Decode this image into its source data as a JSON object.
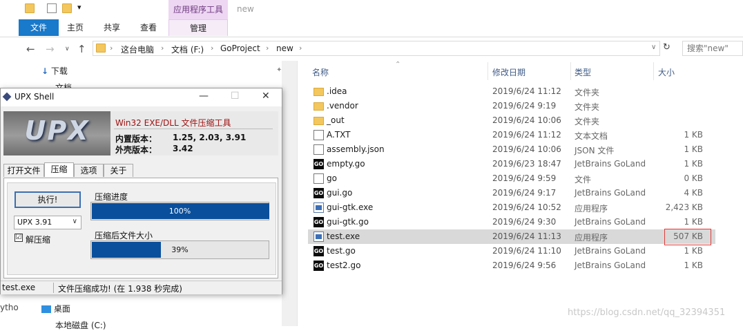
{
  "ribbon": {
    "contextual_tab": "应用程序工具",
    "window_title": "new",
    "tabs": [
      "文件",
      "主页",
      "共享",
      "查看",
      "管理"
    ]
  },
  "address": {
    "crumbs": [
      "这台电脑",
      "文档 (F:)",
      "GoProject",
      "new"
    ],
    "search_placeholder": "搜索\"new\""
  },
  "navpane": {
    "items": [
      "下载",
      "文档",
      "桌面",
      "本地磁盘 (C:)",
      "ytho"
    ]
  },
  "columns": {
    "name": "名称",
    "date": "修改日期",
    "type": "类型",
    "size": "大小"
  },
  "files": [
    {
      "name": ".idea",
      "date": "2019/6/24 11:12",
      "type": "文件夹",
      "size": "",
      "icon": "folder-icon"
    },
    {
      "name": ".vendor",
      "date": "2019/6/24 9:19",
      "type": "文件夹",
      "size": "",
      "icon": "folder-icon"
    },
    {
      "name": "_out",
      "date": "2019/6/24 10:06",
      "type": "文件夹",
      "size": "",
      "icon": "folder-icon"
    },
    {
      "name": "A.TXT",
      "date": "2019/6/24 11:12",
      "type": "文本文档",
      "size": "1 KB",
      "icon": "document-icon"
    },
    {
      "name": "assembly.json",
      "date": "2019/6/24 10:06",
      "type": "JSON 文件",
      "size": "1 KB",
      "icon": "document-icon"
    },
    {
      "name": "empty.go",
      "date": "2019/6/23 18:47",
      "type": "JetBrains GoLand",
      "size": "1 KB",
      "icon": "goland-icon"
    },
    {
      "name": "go",
      "date": "2019/6/24 9:59",
      "type": "文件",
      "size": "0 KB",
      "icon": "document-icon"
    },
    {
      "name": "gui.go",
      "date": "2019/6/24 9:17",
      "type": "JetBrains GoLand",
      "size": "4 KB",
      "icon": "goland-icon"
    },
    {
      "name": "gui-gtk.exe",
      "date": "2019/6/24 10:52",
      "type": "应用程序",
      "size": "2,423 KB",
      "icon": "exe-icon"
    },
    {
      "name": "gui-gtk.go",
      "date": "2019/6/24 9:30",
      "type": "JetBrains GoLand",
      "size": "1 KB",
      "icon": "goland-icon"
    },
    {
      "name": "test.exe",
      "date": "2019/6/24 11:13",
      "type": "应用程序",
      "size": "507 KB",
      "icon": "exe-icon",
      "selected": true
    },
    {
      "name": "test.go",
      "date": "2019/6/24 11:10",
      "type": "JetBrains GoLand",
      "size": "1 KB",
      "icon": "goland-icon"
    },
    {
      "name": "test2.go",
      "date": "2019/6/24 9:56",
      "type": "JetBrains GoLand",
      "size": "1 KB",
      "icon": "goland-icon"
    }
  ],
  "watermark": "https://blog.csdn.net/qq_32394351",
  "upx": {
    "title": "UPX Shell",
    "logo_text": "UPX",
    "info_title": "Win32 EXE/DLL 文件压缩工具",
    "inner_version_label": "内置版本：",
    "inner_version_value": "1.25, 2.03, 3.91",
    "shell_version_label": "外壳版本：",
    "shell_version_value": "3.42",
    "tabs": [
      "打开文件",
      "压缩",
      "选项",
      "关于"
    ],
    "active_tab": 1,
    "execute_label": "执行!",
    "version_select": "UPX 3.91",
    "decompress_label": "解压缩",
    "decompress_checked": "☑",
    "progress_label": "压缩进度",
    "progress_value": 100,
    "progress_text": "100%",
    "ratio_label": "压缩后文件大小",
    "ratio_value": 39,
    "ratio_text": "39%",
    "status_file": "test.exe",
    "status_message": "文件压缩成功!  (在 1.938 秒完成)"
  },
  "colors": {
    "ribbon_file_tab": "#1979ca",
    "progress_fill": "#0a4f9b",
    "highlight_box": "#e03a3a",
    "contextual_tab": "#eed7f3"
  }
}
